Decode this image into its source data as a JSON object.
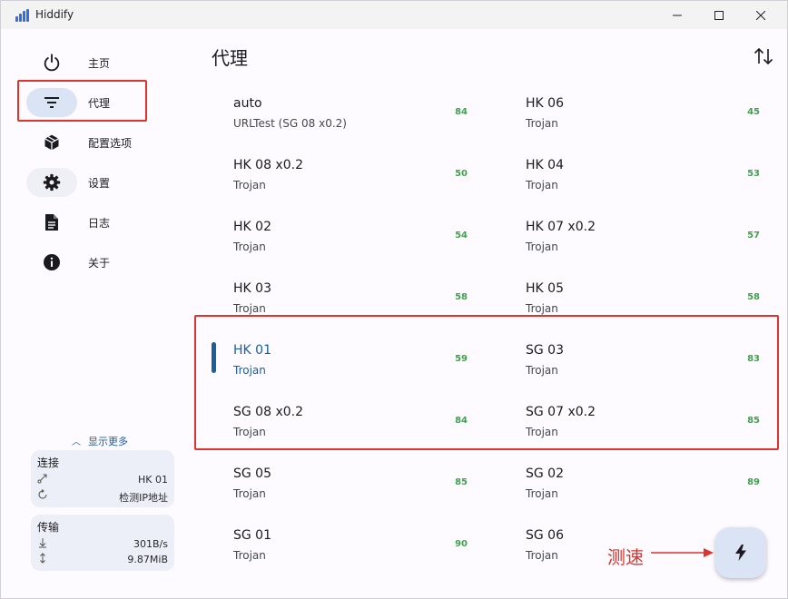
{
  "window": {
    "title": "Hiddify",
    "controls": [
      "minimize",
      "maximize",
      "close"
    ]
  },
  "sidebar": {
    "items": [
      {
        "label": "主页",
        "icon": "power-icon"
      },
      {
        "label": "代理",
        "icon": "filter-icon",
        "active": true
      },
      {
        "label": "配置选项",
        "icon": "cube-icon"
      },
      {
        "label": "设置",
        "icon": "gear-icon"
      },
      {
        "label": "日志",
        "icon": "document-icon"
      },
      {
        "label": "关于",
        "icon": "info-icon"
      }
    ],
    "show_more": "显示更多",
    "connection": {
      "title": "连接",
      "current_proxy": "HK 01",
      "check_ip": "检测IP地址"
    },
    "traffic": {
      "title": "传输",
      "speed": "301B/s",
      "total": "9.87MiB"
    }
  },
  "main": {
    "title": "代理",
    "proxies": [
      {
        "name": "auto",
        "type": "URLTest (SG 08 x0.2)",
        "delay": "84"
      },
      {
        "name": "HK 06",
        "type": "Trojan",
        "delay": "45"
      },
      {
        "name": "HK 08 x0.2",
        "type": "Trojan",
        "delay": "50"
      },
      {
        "name": "HK 04",
        "type": "Trojan",
        "delay": "53"
      },
      {
        "name": "HK 02",
        "type": "Trojan",
        "delay": "54"
      },
      {
        "name": "HK 07 x0.2",
        "type": "Trojan",
        "delay": "57"
      },
      {
        "name": "HK 03",
        "type": "Trojan",
        "delay": "58"
      },
      {
        "name": "HK 05",
        "type": "Trojan",
        "delay": "58"
      },
      {
        "name": "HK 01",
        "type": "Trojan",
        "delay": "59",
        "selected": true
      },
      {
        "name": "SG 03",
        "type": "Trojan",
        "delay": "83"
      },
      {
        "name": "SG 08 x0.2",
        "type": "Trojan",
        "delay": "84"
      },
      {
        "name": "SG 07 x0.2",
        "type": "Trojan",
        "delay": "85"
      },
      {
        "name": "SG 05",
        "type": "Trojan",
        "delay": "85"
      },
      {
        "name": "SG 02",
        "type": "Trojan",
        "delay": "89"
      },
      {
        "name": "SG 01",
        "type": "Trojan",
        "delay": "90"
      },
      {
        "name": "SG 06",
        "type": "Trojan",
        "delay": ""
      }
    ],
    "speed_test_annotation": "测速"
  },
  "colors": {
    "accent": "#1a5f97",
    "delay_green": "#3da34a",
    "highlight_red": "#e0332b",
    "active_pill": "#dbe4f5"
  }
}
